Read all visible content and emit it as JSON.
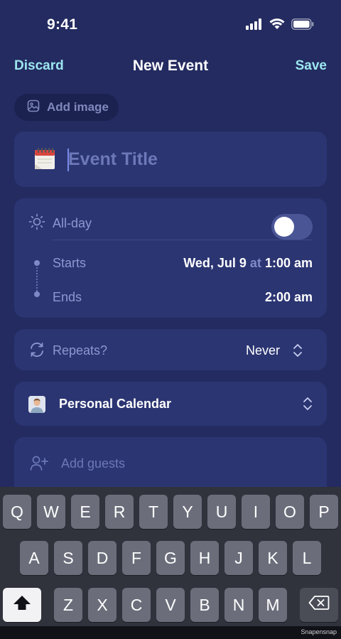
{
  "status_bar": {
    "time": "9:41"
  },
  "nav": {
    "discard": "Discard",
    "title": "New Event",
    "save": "Save"
  },
  "add_image": {
    "label": "Add image"
  },
  "event_title": {
    "placeholder": "Event Title",
    "value": ""
  },
  "time_section": {
    "all_day_label": "All-day",
    "all_day_on": false,
    "starts_label": "Starts",
    "starts_date": "Wed, Jul 9",
    "starts_at": "at",
    "starts_time": "1:00 am",
    "ends_label": "Ends",
    "ends_time": "2:00 am"
  },
  "repeat": {
    "label": "Repeats?",
    "value": "Never"
  },
  "calendar": {
    "label": "Personal Calendar"
  },
  "guests": {
    "label": "Add guests"
  },
  "keyboard": {
    "row1": [
      "Q",
      "W",
      "E",
      "R",
      "T",
      "Y",
      "U",
      "I",
      "O",
      "P"
    ],
    "row2": [
      "A",
      "S",
      "D",
      "F",
      "G",
      "H",
      "J",
      "K",
      "L"
    ],
    "row3": [
      "Z",
      "X",
      "C",
      "V",
      "B",
      "N",
      "M"
    ]
  },
  "watermark": "Snapensnap",
  "colors": {
    "background": "#232b60",
    "card": "#2b3572",
    "accent": "#9ce6ef",
    "muted_text": "#8d97cf",
    "keyboard": "#30323c",
    "key": "#6b6e7a"
  }
}
